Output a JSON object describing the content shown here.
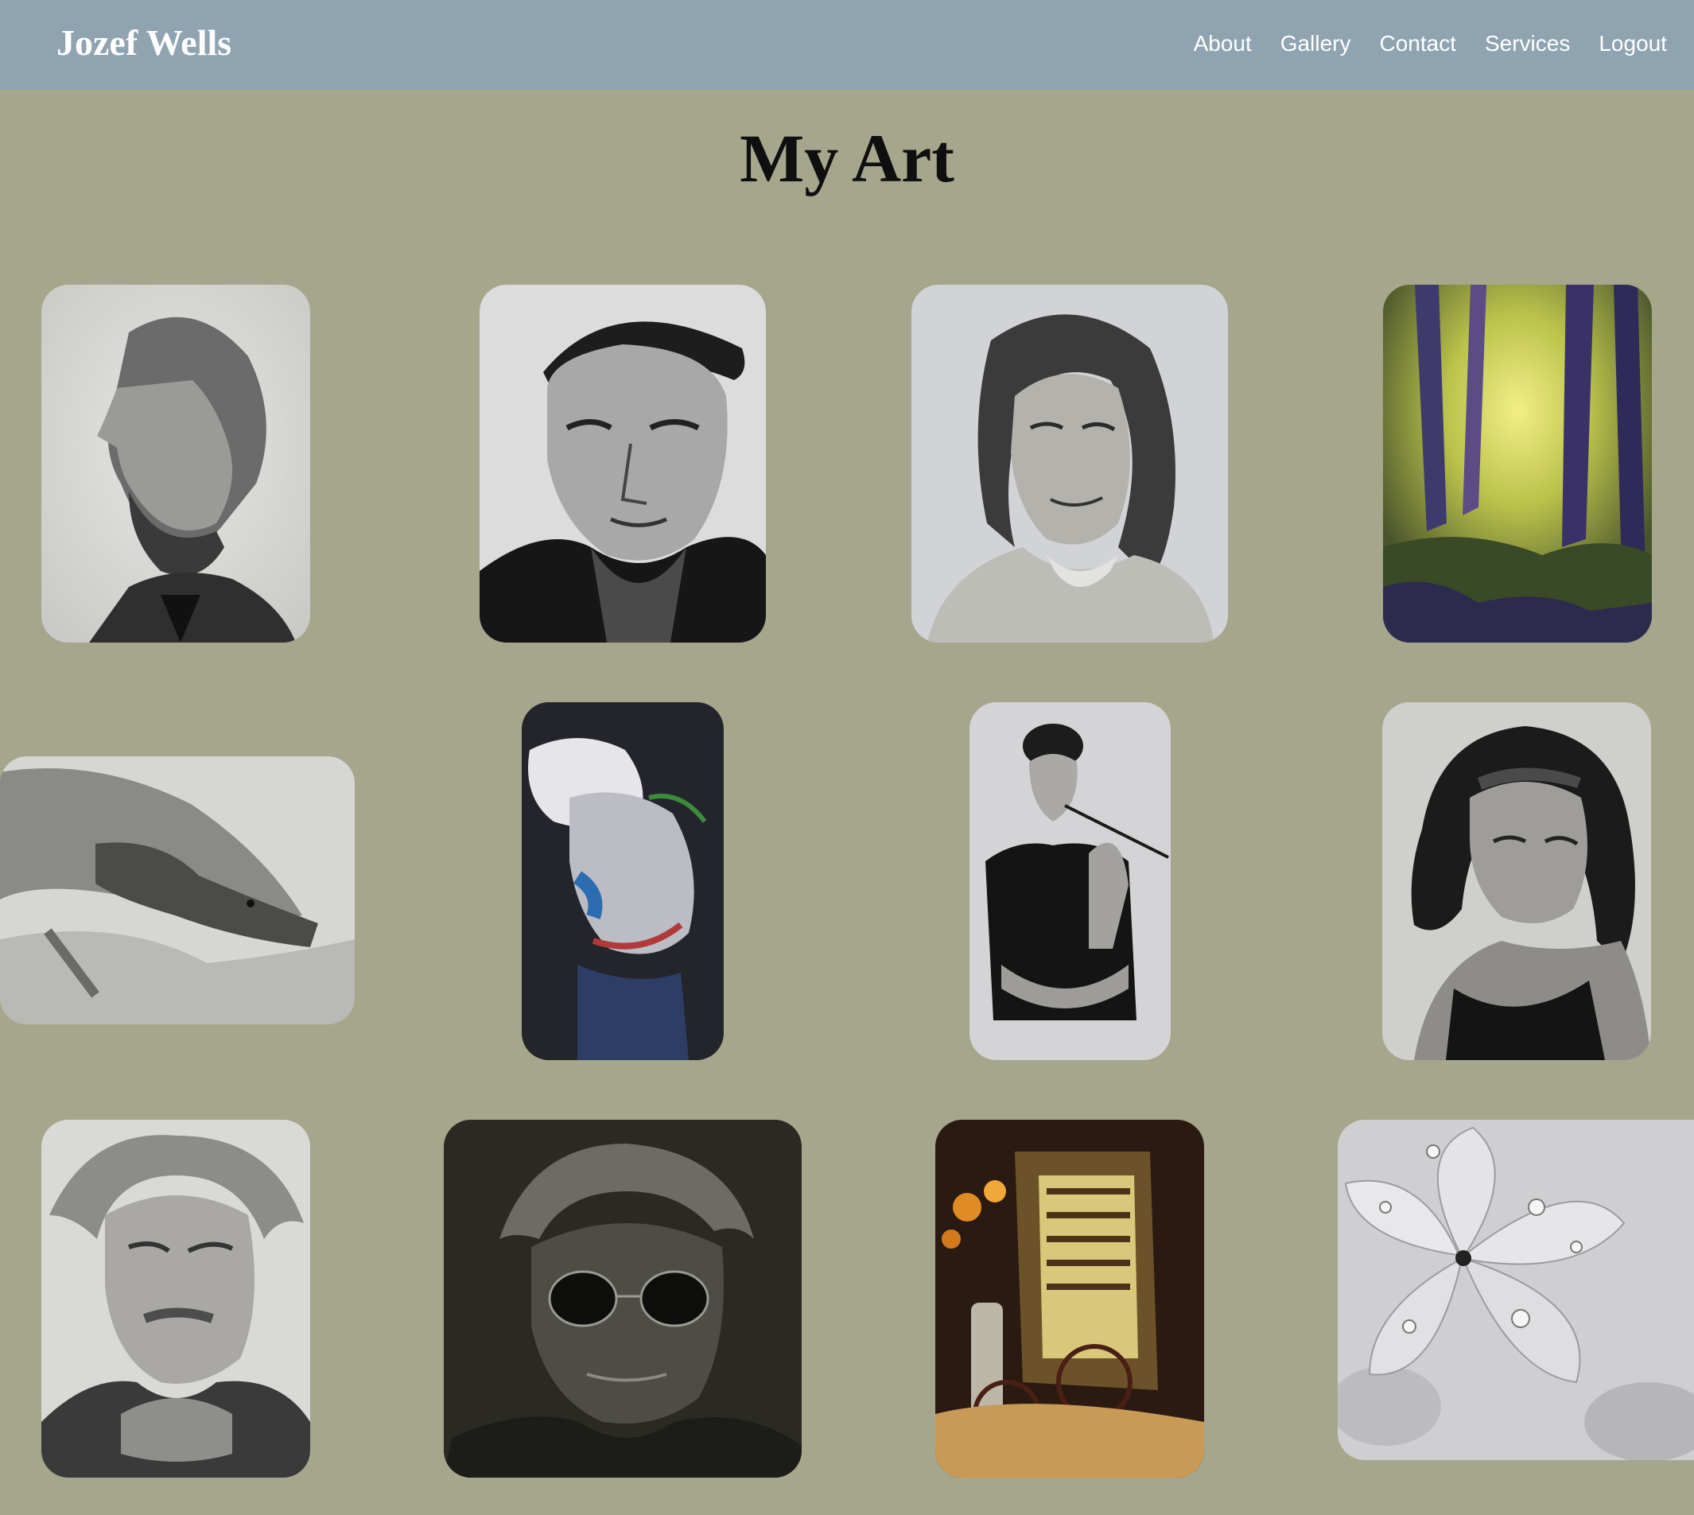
{
  "header": {
    "brand": "Jozef Wells",
    "nav": [
      {
        "label": "About"
      },
      {
        "label": "Gallery"
      },
      {
        "label": "Contact"
      },
      {
        "label": "Services"
      },
      {
        "label": "Logout"
      }
    ]
  },
  "main": {
    "title": "My Art"
  },
  "colors": {
    "navbar": "#8fa3b1",
    "page_background": "#a5a68b",
    "nav_text": "#ffffff",
    "title_text": "#0f0f0f"
  }
}
